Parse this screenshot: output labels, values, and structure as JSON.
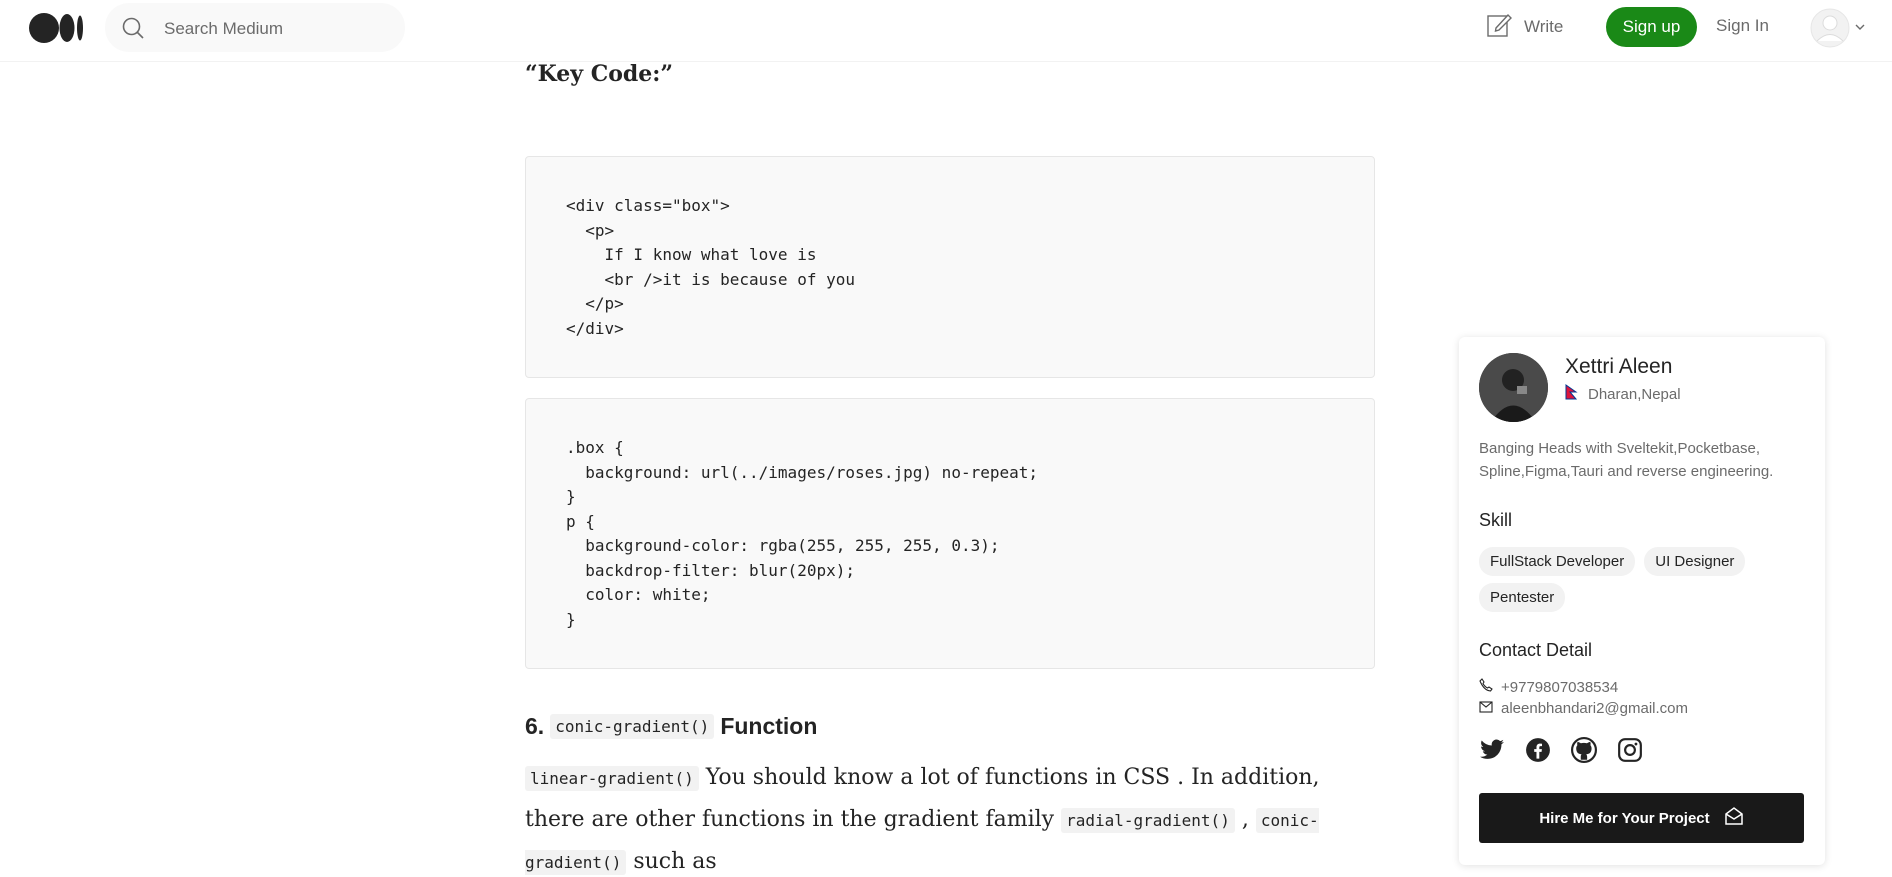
{
  "header": {
    "search_placeholder": "Search Medium",
    "write_label": "Write",
    "signup_label": "Sign up",
    "signin_label": "Sign In"
  },
  "article": {
    "key_code_heading": "“Key Code:”",
    "code_html": "<div class=\"box\">\n  <p>\n    If I know what love is\n    <br />it is because of you\n  </p>\n</div>",
    "code_css": ".box {\n  background: url(../images/roses.jpg) no-repeat;\n}\np {\n  background-color: rgba(255, 255, 255, 0.3);\n  backdrop-filter: blur(20px);\n  color: white;\n}",
    "section_number": "6.",
    "section_code": "conic-gradient()",
    "section_word": "Function",
    "para_code1": "linear-gradient()",
    "para_text1": " You should know a lot of functions in CSS . In addition, there are other functions in the gradient family ",
    "para_code2": "radial-gradient()",
    "para_text2": " , ",
    "para_code3": "conic-gradient()",
    "para_text3": " such as"
  },
  "profile": {
    "name": "Xettri Aleen",
    "location": "Dharan,Nepal",
    "bio": "Banging Heads with Sveltekit,Pocketbase, Spline,Figma,Tauri and reverse engineering.",
    "skill_title": "Skill",
    "skills": [
      "FullStack Developer",
      "UI Designer",
      "Pentester"
    ],
    "contact_title": "Contact Detail",
    "phone": "+9779807038534",
    "email": "aleenbhandari2@gmail.com",
    "socials": [
      "twitter-icon",
      "facebook-icon",
      "github-icon",
      "instagram-icon"
    ],
    "hire_label": "Hire Me for Your Project"
  },
  "colors": {
    "brand_green": "#1a8917",
    "text": "#242424",
    "muted": "#6b6b6b",
    "code_bg": "#f9f9f9",
    "hire_bg": "#191919"
  }
}
